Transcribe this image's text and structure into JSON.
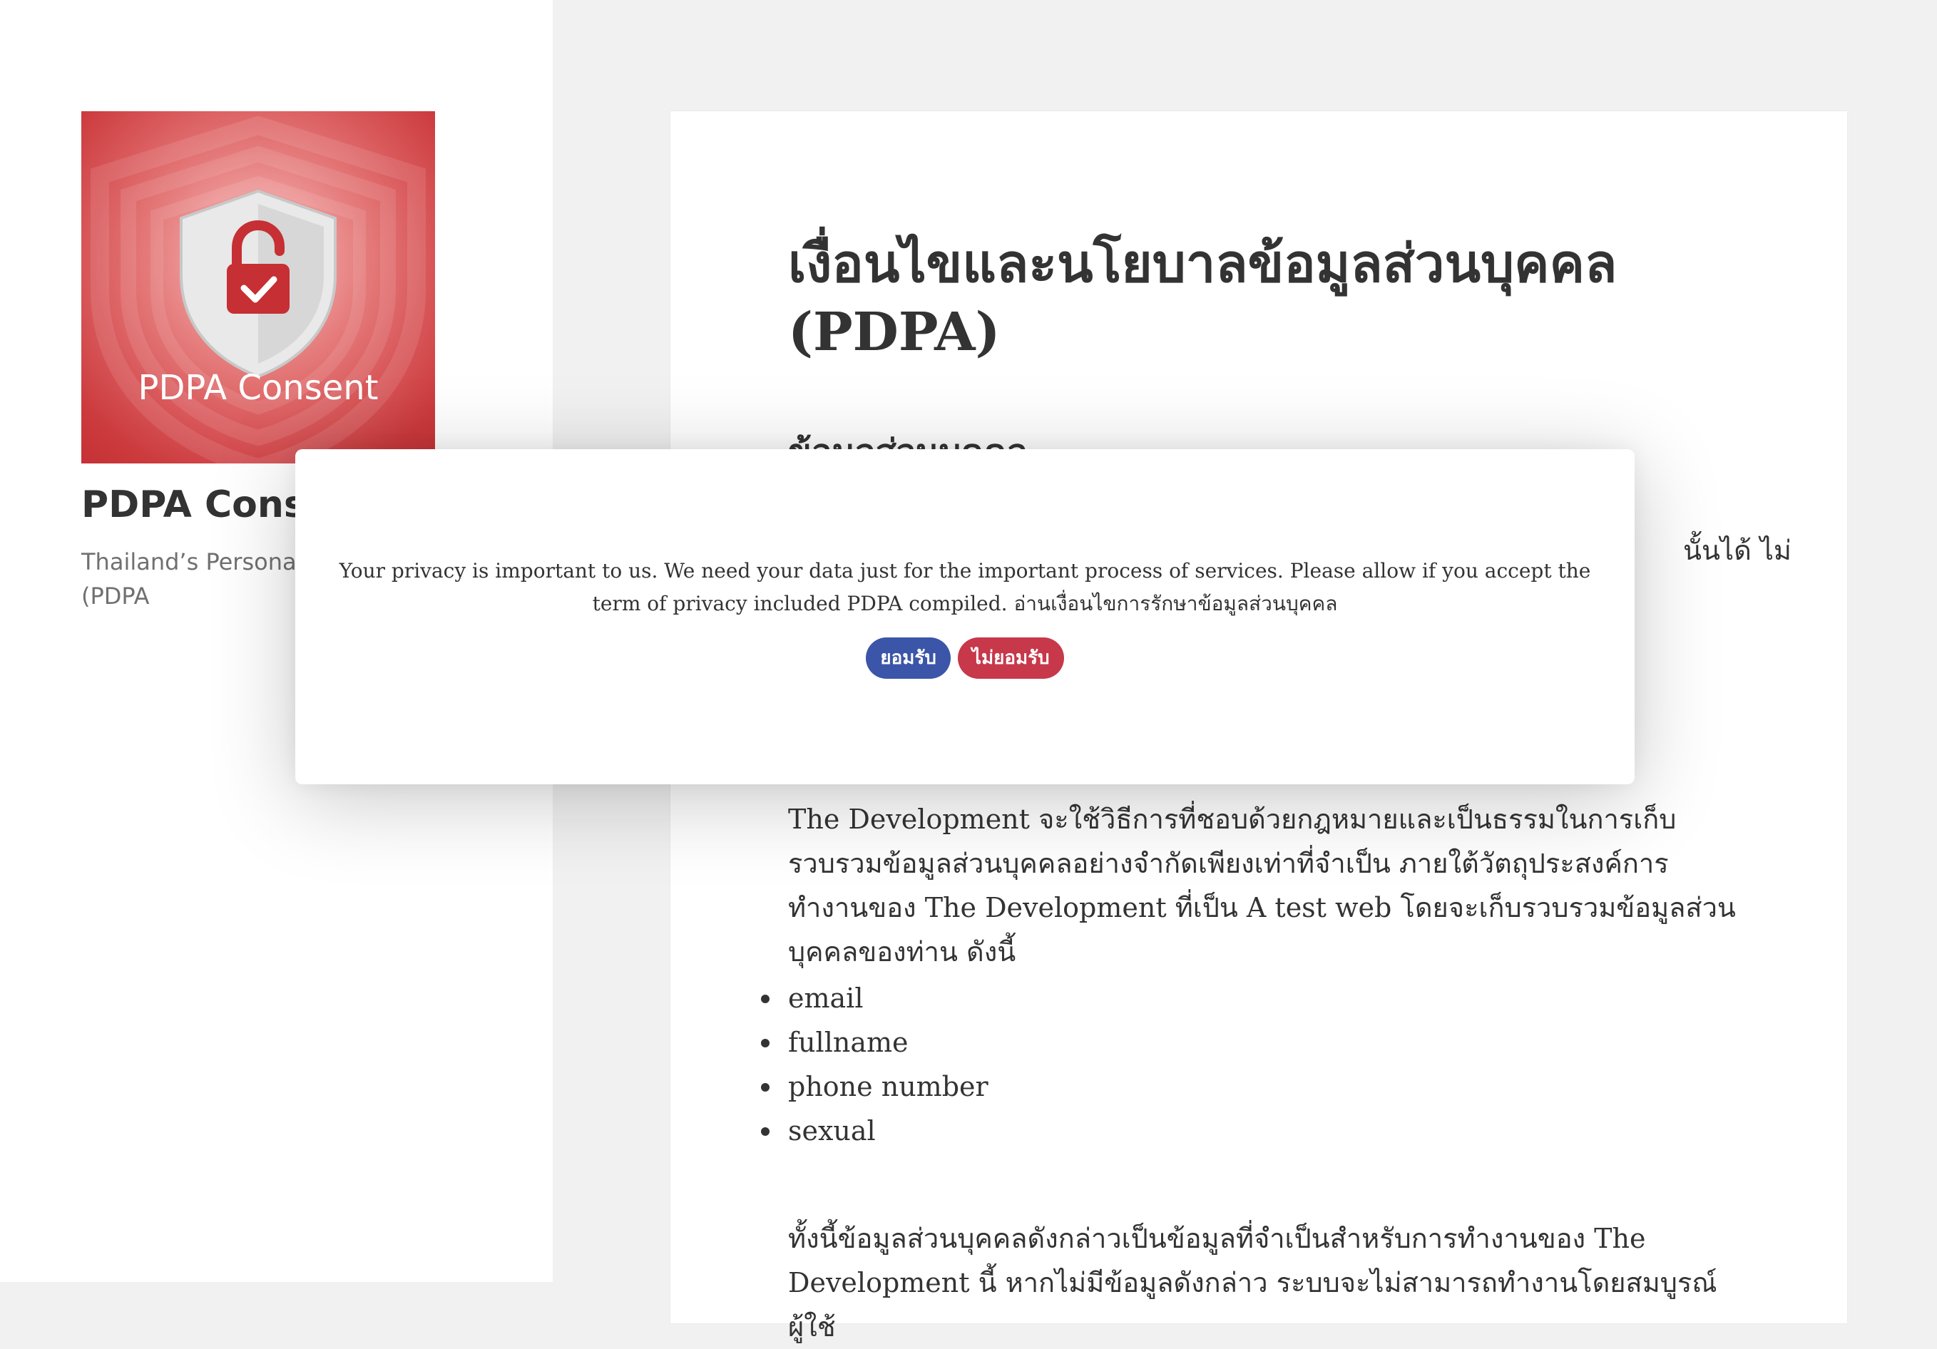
{
  "sidebar": {
    "logo_caption": "PDPA Consent",
    "site_title": "PDPA Conse",
    "site_description": "Thailand’s Personal Protection Act (PDPA"
  },
  "article": {
    "title": "เงื่อนไขและนโยบาลข้อมูลส่วนบุคคล (PDPA)",
    "section_heading": "ข้อมูลส่วนบุคคล",
    "fragment_text": "นั้นได้ ไม่",
    "paragraph_1": "The Development จะใช้วิธีการที่ชอบด้วยกฎหมายและเป็นธรรมในการเก็บรวบรวมข้อมูลส่วนบุคคลอย่างจำกัดเพียงเท่าที่จำเป็น ภายใต้วัตถุประสงค์การทำงานของ The Development ที่เป็น A test web โดยจะเก็บรวบรวมข้อมูลส่วนบุคคลของท่าน ดังนี้",
    "bullets": [
      "email",
      "fullname",
      "phone number",
      "sexual"
    ],
    "paragraph_2": "ทั้งนี้ข้อมูลส่วนบุคคลดังกล่าวเป็นข้อมูลที่จำเป็นสำหรับการทำงานของ The Development นี้ หากไม่มีข้อมูลดังกล่าว ระบบจะไม่สามารถทำงานโดยสมบูรณ์ ผู้ใช้"
  },
  "modal": {
    "message": "Your privacy is important to us. We need your data just for the important process of services. Please allow if you accept the term of privacy included PDPA compiled. อ่านเงื่อนไขการรักษาข้อมูลส่วนบุคคล",
    "accept_label": "ยอมรับ",
    "decline_label": "ไม่ยอมรับ"
  },
  "colors": {
    "accept_button": "#3b55a8",
    "decline_button": "#c7384a",
    "logo_red": "#cb3a3d"
  }
}
